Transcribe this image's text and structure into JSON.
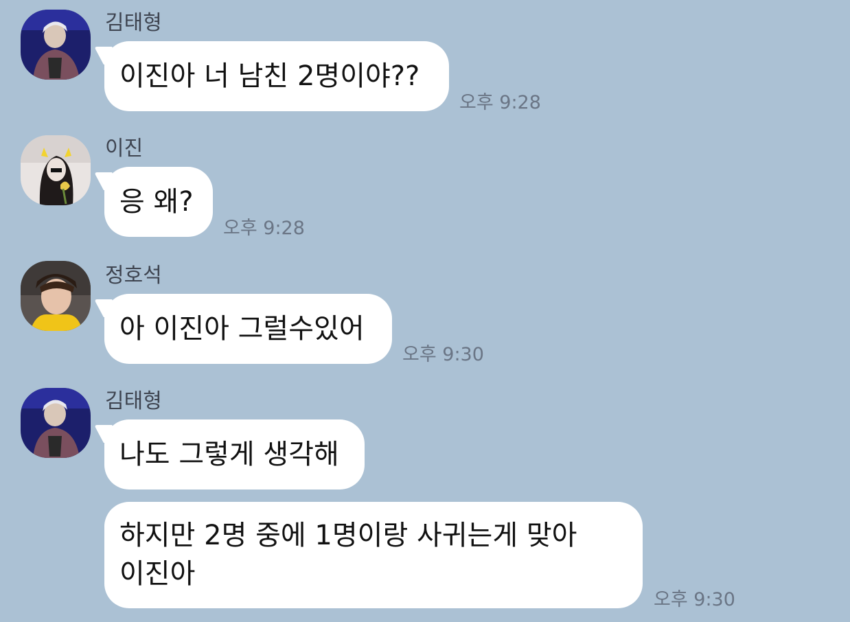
{
  "messages": [
    {
      "sender": "김태형",
      "text": "이진아 너 남친 2명이야??",
      "time": "오후 9:28"
    },
    {
      "sender": "이진",
      "text": "응 왜?",
      "time": "오후 9:28"
    },
    {
      "sender": "정호석",
      "text": "아 이진아 그럴수있어",
      "time": "오후 9:30"
    },
    {
      "sender": "김태형",
      "text": "나도 그렇게 생각해"
    },
    {
      "text_line1": "하지만 2명 중에 1명이랑 사귀는게 맞아",
      "text_line2": "이진아",
      "time": "오후 9:30"
    }
  ],
  "colors": {
    "background": "#abc1d4",
    "bubble": "#ffffff",
    "name": "#3e4450",
    "time": "#6a7585"
  }
}
